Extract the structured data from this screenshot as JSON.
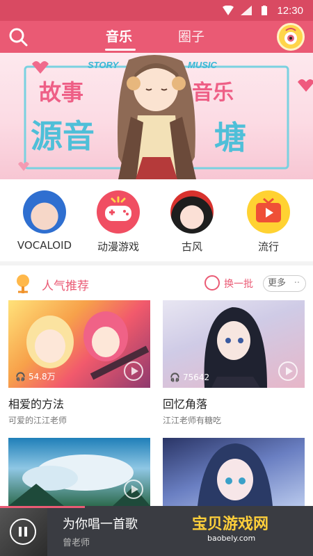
{
  "status": {
    "time": "12:30"
  },
  "nav": {
    "tabs": [
      {
        "label": "音乐"
      },
      {
        "label": "圈子"
      }
    ]
  },
  "banner": {
    "left_title": "故事",
    "left_title2": "源音",
    "right_title": "音乐",
    "right_title2": "塘",
    "left_tag": "STORY",
    "right_tag": "MUSIC"
  },
  "categories": [
    {
      "label": "VOCALOID"
    },
    {
      "label": "动漫游戏"
    },
    {
      "label": "古风"
    },
    {
      "label": "流行"
    }
  ],
  "recommend": {
    "title": "人气推荐",
    "refresh": "换一批",
    "more": "更多",
    "cards": [
      {
        "name": "相爱的方法",
        "author": "可爱的江江老师",
        "plays": "54.8万"
      },
      {
        "name": "回忆角落",
        "author": "江江老师有糖吃",
        "plays": "75642"
      },
      {
        "name": "",
        "author": "",
        "plays": ""
      },
      {
        "name": "",
        "author": "",
        "plays": ""
      }
    ]
  },
  "player": {
    "song": "为你唱一首歌",
    "artist": "曾老师",
    "progress": 0.27
  },
  "watermark": {
    "text": "宝贝游戏网",
    "sub": "baobely.com"
  },
  "colors": {
    "accent": "#ea5a74",
    "status_bar": "#d94a62",
    "player_bg": "#3a3c42"
  }
}
